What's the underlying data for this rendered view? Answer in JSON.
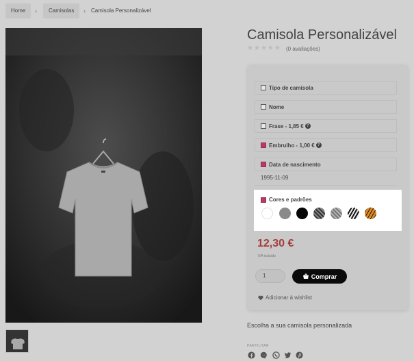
{
  "breadcrumb": {
    "items": [
      {
        "label": "Home"
      },
      {
        "label": "Camisolas"
      },
      {
        "label": "Camisola Personalizável"
      }
    ],
    "separator": "›"
  },
  "product": {
    "title": "Camisola Personalizável",
    "rating": {
      "stars": 0,
      "max": 5,
      "reviews_text": "(0 avaliações)"
    },
    "options": [
      {
        "label": "Tipo de camisola",
        "checked": false,
        "has_help": false
      },
      {
        "label": "Nome",
        "checked": false,
        "has_help": false
      },
      {
        "label": "Frase - 1,85 €",
        "checked": false,
        "has_help": true
      },
      {
        "label": "Embrulho - 1,00 €",
        "checked": true,
        "has_help": true
      },
      {
        "label": "Data de nascimento",
        "checked": true,
        "has_help": false
      }
    ],
    "date_value": "1995-11-09",
    "colors": {
      "label": "Cores e padrões",
      "checked": true,
      "swatches": [
        {
          "name": "white",
          "color": "#ffffff"
        },
        {
          "name": "grey",
          "color": "#8a8a8a"
        },
        {
          "name": "black",
          "color": "#050505"
        },
        {
          "name": "dark-plaid-pattern",
          "color": "#555555"
        },
        {
          "name": "grey-plaid-pattern",
          "color": "#9a9a9a"
        },
        {
          "name": "zebra-pattern",
          "color": "#222222"
        },
        {
          "name": "tiger-pattern",
          "color": "#e08a1e"
        }
      ]
    },
    "price": "12,30 €",
    "tax_text": "IVA incluído",
    "quantity": "1",
    "buy_label": "Comprar",
    "wishlist_label": "Adicionar à wishlist",
    "description": "Escolha a sua camisola personalizada",
    "share_label": "PARTILHAR",
    "share_icons": [
      "facebook-icon",
      "messenger-icon",
      "whatsapp-icon",
      "twitter-icon",
      "pinterest-icon"
    ]
  },
  "colors": {
    "accent": "#b83a60",
    "price": "#a53b3b",
    "button": "#0a0a0a"
  }
}
